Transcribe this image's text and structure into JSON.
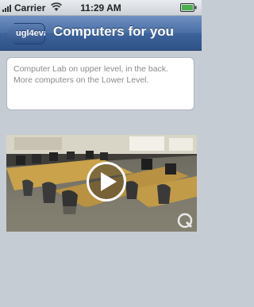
{
  "status_bar": {
    "carrier": "Carrier",
    "time": "11:29 AM"
  },
  "nav_bar": {
    "back_label": "ugl4eva",
    "title": "Computers for you"
  },
  "info": {
    "text": "Computer Lab on upper level, in the back. More computers on the Lower Level."
  },
  "video": {
    "play_icon": "play-icon",
    "badge_icon": "quicktime-icon"
  },
  "colors": {
    "nav_bar": "#3d639b",
    "background": "#c5ccd4",
    "card_text": "#8a8a8a"
  }
}
